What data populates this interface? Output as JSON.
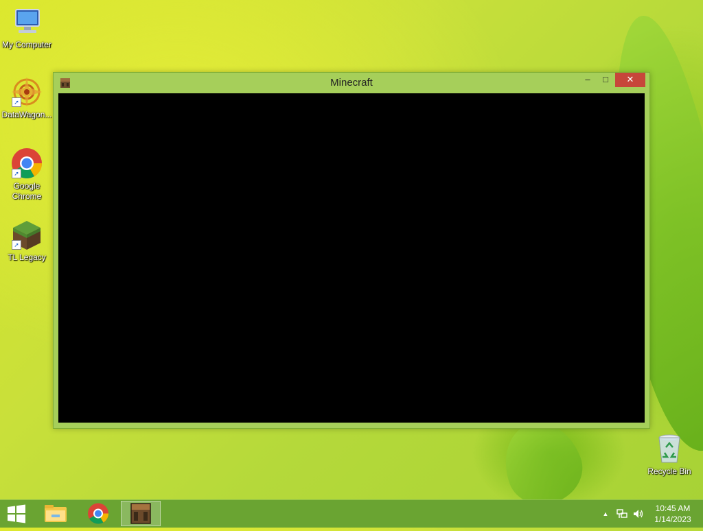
{
  "desktop": {
    "icons": [
      {
        "label": "My Computer",
        "icon": "computer-icon"
      },
      {
        "label": "DataWagon...",
        "icon": "datawagon-icon"
      },
      {
        "label": "Google Chrome",
        "icon": "chrome-icon"
      },
      {
        "label": "TL Legacy",
        "icon": "grass-block-icon"
      }
    ],
    "recycle_bin": {
      "label": "Recycle Bin",
      "icon": "recycle-bin-icon"
    }
  },
  "window": {
    "title": "Minecraft",
    "icon": "crafting-table-icon",
    "buttons": {
      "minimize": "minimize-icon",
      "maximize": "maximize-icon",
      "close": "close-icon"
    },
    "client_color": "#000000",
    "frame_color": "#a6cf5a"
  },
  "taskbar": {
    "color": "#6aa432",
    "start": "windows-logo-icon",
    "pinned": [
      "file-explorer-icon",
      "chrome-icon",
      "crafting-table-icon"
    ],
    "active_index": 2,
    "tray": [
      "show-hidden-icons-arrow",
      "network-icon",
      "volume-icon"
    ],
    "clock": {
      "time": "10:45 AM",
      "date": "1/14/2023"
    }
  }
}
